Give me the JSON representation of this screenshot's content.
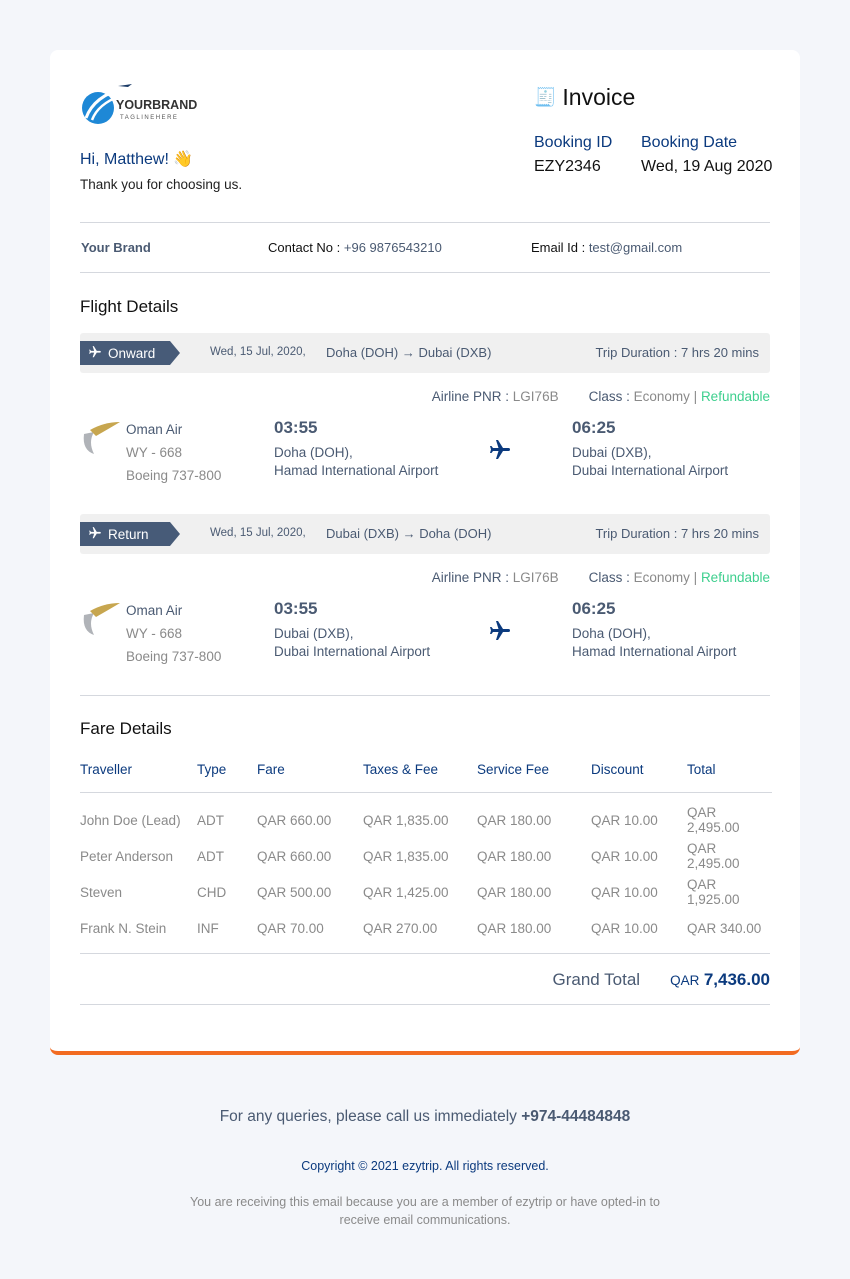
{
  "brand": {
    "name": "YOURBRAND",
    "tagline": "TAGLINEHERE"
  },
  "greeting": "Hi, Matthew! 👋",
  "thanks": "Thank you for choosing us.",
  "invoice": {
    "title": "Invoice",
    "booking_id_label": "Booking ID",
    "booking_id": "EZY2346",
    "booking_date_label": "Booking Date",
    "booking_date": "Wed, 19 Aug 2020"
  },
  "contact": {
    "brand": "Your Brand",
    "contact_label": "Contact No :",
    "contact": "+96 9876543210",
    "email_label": "Email Id :",
    "email": "test@gmail.com"
  },
  "flight_title": "Flight Details",
  "flights": [
    {
      "badge": "Onward",
      "date": "Wed, 15 Jul, 2020,",
      "route": "Doha (DOH) → Dubai (DXB)",
      "duration": "Trip Duration : 7 hrs 20 mins",
      "pnr_label": "Airline PNR :",
      "pnr": "LGI76B",
      "class_label": "Class :",
      "class": "Economy",
      "sep": "|",
      "refund": "Refundable",
      "airline": "Oman Air",
      "flight_no": "WY - 668",
      "aircraft": "Boeing 737-800",
      "dep_time": "03:55",
      "dep_city": "Doha (DOH),",
      "dep_airport": "Hamad International Airport",
      "arr_time": "06:25",
      "arr_city": "Dubai (DXB),",
      "arr_airport": "Dubai International Airport"
    },
    {
      "badge": "Return",
      "date": "Wed, 15 Jul, 2020,",
      "route": "Dubai (DXB) → Doha (DOH)",
      "duration": "Trip Duration : 7 hrs 20 mins",
      "pnr_label": "Airline PNR :",
      "pnr": "LGI76B",
      "class_label": "Class :",
      "class": "Economy",
      "sep": "|",
      "refund": "Refundable",
      "airline": "Oman Air",
      "flight_no": "WY - 668",
      "aircraft": "Boeing 737-800",
      "dep_time": "03:55",
      "dep_city": "Dubai (DXB),",
      "dep_airport": "Dubai International Airport",
      "arr_time": "06:25",
      "arr_city": "Doha (DOH),",
      "arr_airport": "Hamad International Airport"
    }
  ],
  "fare_title": "Fare Details",
  "fare_headers": [
    "Traveller",
    "Type",
    "Fare",
    "Taxes & Fee",
    "Service Fee",
    "Discount",
    "Total"
  ],
  "fare_rows": [
    [
      "John Doe (Lead)",
      "ADT",
      "QAR 660.00",
      "QAR 1,835.00",
      "QAR 180.00",
      "QAR 10.00",
      "QAR 2,495.00"
    ],
    [
      "Peter Anderson",
      "ADT",
      "QAR 660.00",
      "QAR 1,835.00",
      "QAR 180.00",
      "QAR 10.00",
      "QAR 2,495.00"
    ],
    [
      "Steven",
      "CHD",
      "QAR 500.00",
      "QAR 1,425.00",
      "QAR 180.00",
      "QAR 10.00",
      "QAR 1,925.00"
    ],
    [
      "Frank N. Stein",
      "INF",
      "QAR 70.00",
      "QAR 270.00",
      "QAR 180.00",
      "QAR 10.00",
      "QAR 340.00"
    ]
  ],
  "grand_total": {
    "label": "Grand Total",
    "currency": "QAR",
    "amount": "7,436.00"
  },
  "footer": {
    "query": "For any queries, please call us immediately",
    "phone": "+974-44484848",
    "copyright": "Copyright © 2021 ezytrip. All rights reserved.",
    "notice": "You are receiving this email because you are a member of ezytrip or have opted-in to receive email communications."
  }
}
